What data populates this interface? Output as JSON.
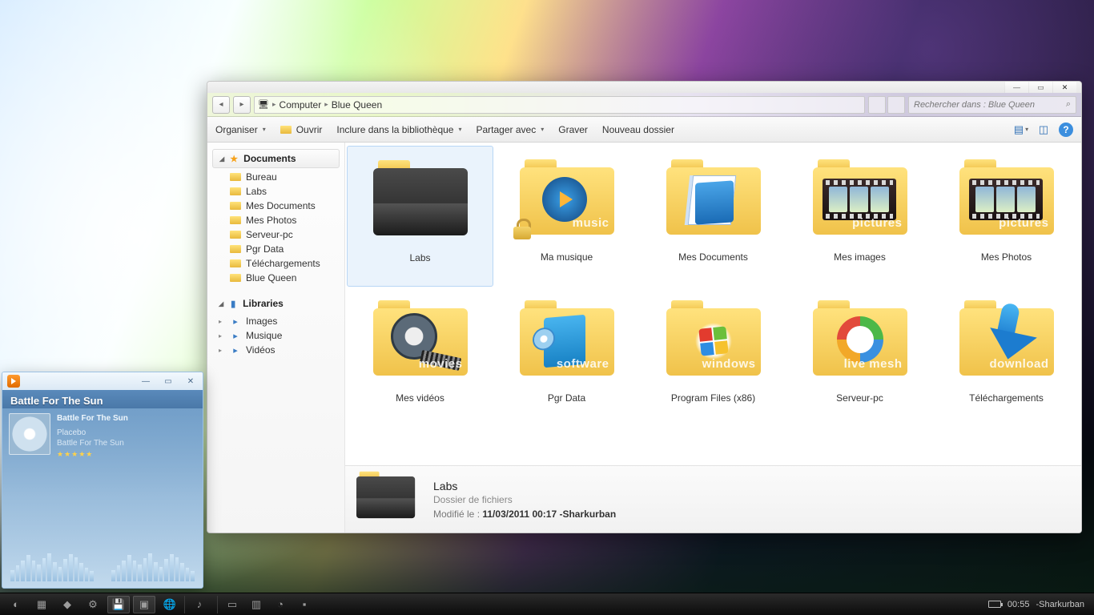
{
  "explorer": {
    "breadcrumb": [
      "Computer",
      "Blue Queen"
    ],
    "search_placeholder": "Rechercher dans : Blue Queen",
    "toolbar": {
      "organiser": "Organiser",
      "ouvrir": "Ouvrir",
      "inclure": "Inclure dans la bibliothèque",
      "partager": "Partager avec",
      "graver": "Graver",
      "nouveau": "Nouveau dossier"
    },
    "sidebar": {
      "documents_header": "Documents",
      "documents": [
        "Bureau",
        "Labs",
        "Mes Documents",
        "Mes Photos",
        "Serveur-pc",
        "Pgr Data",
        "Téléchargements",
        "Blue Queen"
      ],
      "libraries_header": "Libraries",
      "libraries": [
        "Images",
        "Musique",
        "Vidéos"
      ]
    },
    "items": [
      {
        "label": "Labs",
        "kind": "dark",
        "selected": true
      },
      {
        "label": "Ma musique",
        "kind": "music",
        "overlay": "music"
      },
      {
        "label": "Mes Documents",
        "kind": "docs"
      },
      {
        "label": "Mes images",
        "kind": "pictures",
        "overlay": "pictures"
      },
      {
        "label": "Mes Photos",
        "kind": "pictures",
        "overlay": "pictures"
      },
      {
        "label": "Mes vidéos",
        "kind": "movies",
        "overlay": "movies"
      },
      {
        "label": "Pgr Data",
        "kind": "software",
        "overlay": "software"
      },
      {
        "label": "Program Files (x86)",
        "kind": "windows",
        "overlay": "windows"
      },
      {
        "label": "Serveur-pc",
        "kind": "mesh",
        "overlay": "live mesh"
      },
      {
        "label": "Téléchargements",
        "kind": "download",
        "overlay": "download"
      }
    ],
    "details": {
      "title": "Labs",
      "subtitle": "Dossier de fichiers",
      "modified_label": "Modifié le :",
      "modified_value": "11/03/2011 00:17 -Sharkurban"
    }
  },
  "player": {
    "song_title": "Battle For The Sun",
    "track": "Battle For The Sun",
    "artist": "Placebo",
    "album": "Battle For The Sun",
    "stars": "★★★★★"
  },
  "taskbar": {
    "time": "00:55",
    "user": "-Sharkurban"
  }
}
